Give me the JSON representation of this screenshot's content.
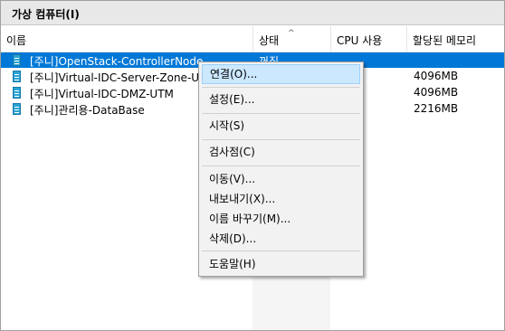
{
  "panel": {
    "title": "가상 컴퓨터(I)"
  },
  "columns": {
    "name": "이름",
    "state": "상태",
    "cpu": "CPU 사용",
    "memory": "할당된 메모리"
  },
  "icons": {
    "sort": "sort-ascending-caret-icon",
    "vm": "virtual-machine-icon"
  },
  "colors": {
    "selection": "#0078d7",
    "menu_hover": "#cce8ff"
  },
  "vms": [
    {
      "name": "[주니]OpenStack-ControllerNode",
      "state": "꺼짐",
      "memory": ""
    },
    {
      "name": "[주니]Virtual-IDC-Server-Zone-U",
      "state": "",
      "memory": "4096MB"
    },
    {
      "name": "[주니]Virtual-IDC-DMZ-UTM",
      "state": "",
      "memory": "4096MB"
    },
    {
      "name": "[주니]관리용-DataBase",
      "state": "",
      "memory": "2216MB"
    }
  ],
  "context_menu": {
    "connect": "연결(O)...",
    "settings": "설정(E)...",
    "start": "시작(S)",
    "checkpoint": "검사점(C)",
    "move": "이동(V)...",
    "export": "내보내기(X)...",
    "rename": "이름 바꾸기(M)...",
    "delete": "삭제(D)...",
    "help": "도움말(H)"
  }
}
